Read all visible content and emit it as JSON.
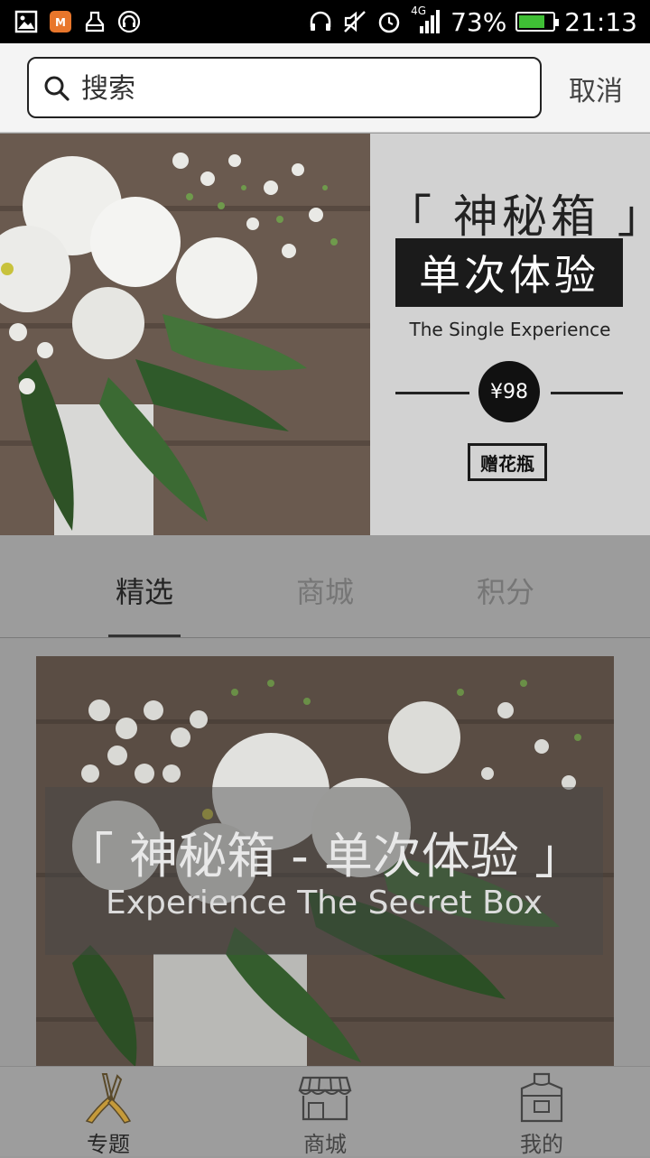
{
  "status_bar": {
    "signal": "4G",
    "battery_percent": "73%",
    "time": "21:13",
    "icons_left": [
      "gallery-icon",
      "app-icon",
      "clean-icon",
      "headset-app-icon"
    ],
    "icons_right": [
      "headphones-icon",
      "mute-icon",
      "alarm-icon",
      "signal-icon",
      "battery-icon"
    ]
  },
  "search": {
    "placeholder": "搜索",
    "cancel_label": "取消"
  },
  "banner": {
    "title": "「 神秘箱 」",
    "subtitle": "单次体验",
    "english": "The Single Experience",
    "price": "¥98",
    "gift": "赠花瓶"
  },
  "tabs": [
    {
      "label": "精选",
      "active": true
    },
    {
      "label": "商城",
      "active": false
    },
    {
      "label": "积分",
      "active": false
    }
  ],
  "card": {
    "title": "「 神秘箱 - 单次体验 」",
    "subtitle": "Experience The Secret Box"
  },
  "bottom_nav": [
    {
      "label": "专题",
      "icon": "pruning-shears-icon",
      "active": true
    },
    {
      "label": "商城",
      "icon": "storefront-icon",
      "active": false
    },
    {
      "label": "我的",
      "icon": "apron-icon",
      "active": false
    }
  ],
  "colors": {
    "accent_active": "#b08a35",
    "overlay_dim": "#9c9c9c",
    "battery": "#3fbf35"
  }
}
